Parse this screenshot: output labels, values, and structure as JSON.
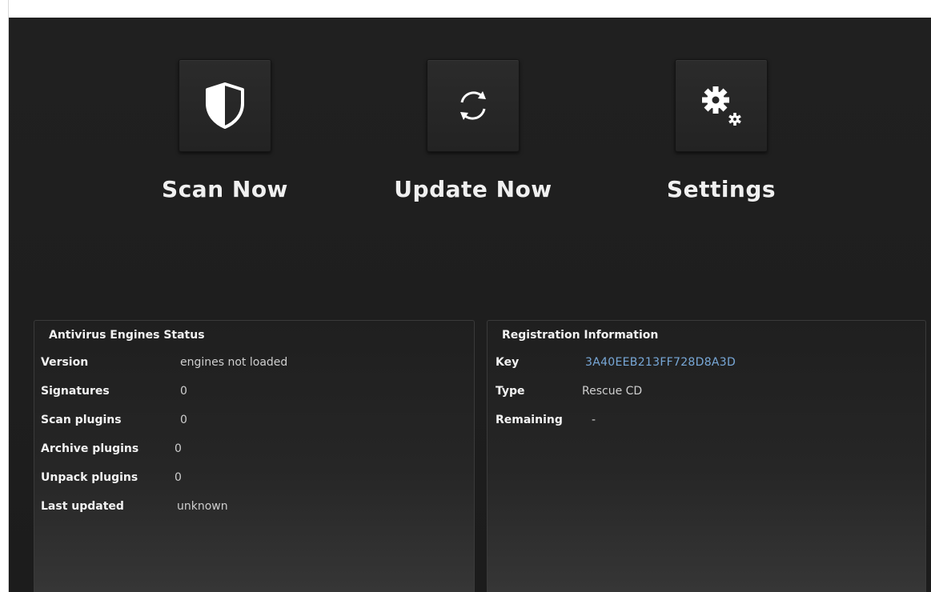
{
  "actions": {
    "scan": {
      "label": "Scan Now",
      "icon": "shield-icon"
    },
    "update": {
      "label": "Update Now",
      "icon": "refresh-icon"
    },
    "settings": {
      "label": "Settings",
      "icon": "gears-icon"
    }
  },
  "engines": {
    "title": "Antivirus Engines Status",
    "rows": [
      {
        "label": "Version",
        "value": "engines not loaded"
      },
      {
        "label": "Signatures",
        "value": "0"
      },
      {
        "label": "Scan plugins",
        "value": "0"
      },
      {
        "label": "Archive plugins",
        "value": "0"
      },
      {
        "label": "Unpack plugins",
        "value": "0"
      },
      {
        "label": "Last updated",
        "value": "unknown"
      }
    ]
  },
  "registration": {
    "title": "Registration Information",
    "rows": [
      {
        "label": "Key",
        "value": "3A40EEB213FF728D8A3D"
      },
      {
        "label": "Type",
        "value": "Rescue CD"
      },
      {
        "label": "Remaining",
        "value": "-"
      }
    ]
  },
  "colors": {
    "background": "#1f1f1f",
    "text": "#f0f0f0",
    "key_link": "#78a8d8"
  }
}
